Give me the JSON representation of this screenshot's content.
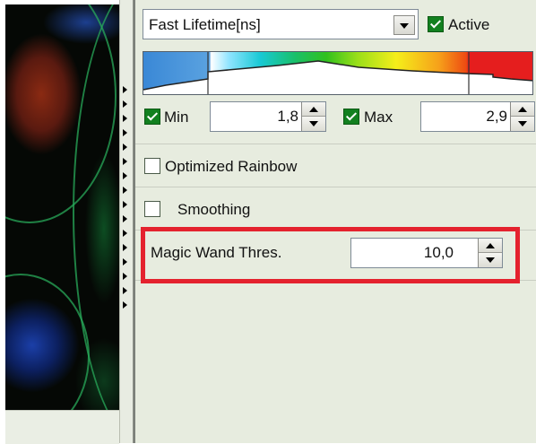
{
  "lifetime_dropdown": {
    "selected": "Fast Lifetime[ns]"
  },
  "active": {
    "label": "Active",
    "checked": true
  },
  "colorbar": {
    "left_color": "#3a88d6",
    "right_color": "#e51e1e"
  },
  "min": {
    "label": "Min",
    "checked": true,
    "value": "1,8"
  },
  "max": {
    "label": "Max",
    "checked": true,
    "value": "2,9"
  },
  "optimized_rainbow": {
    "label": "Optimized Rainbow",
    "checked": false
  },
  "smoothing": {
    "label": "Smoothing",
    "checked": false
  },
  "magic_wand": {
    "label": "Magic Wand Thres.",
    "value": "10,0"
  },
  "highlight_color": "#e4222e"
}
